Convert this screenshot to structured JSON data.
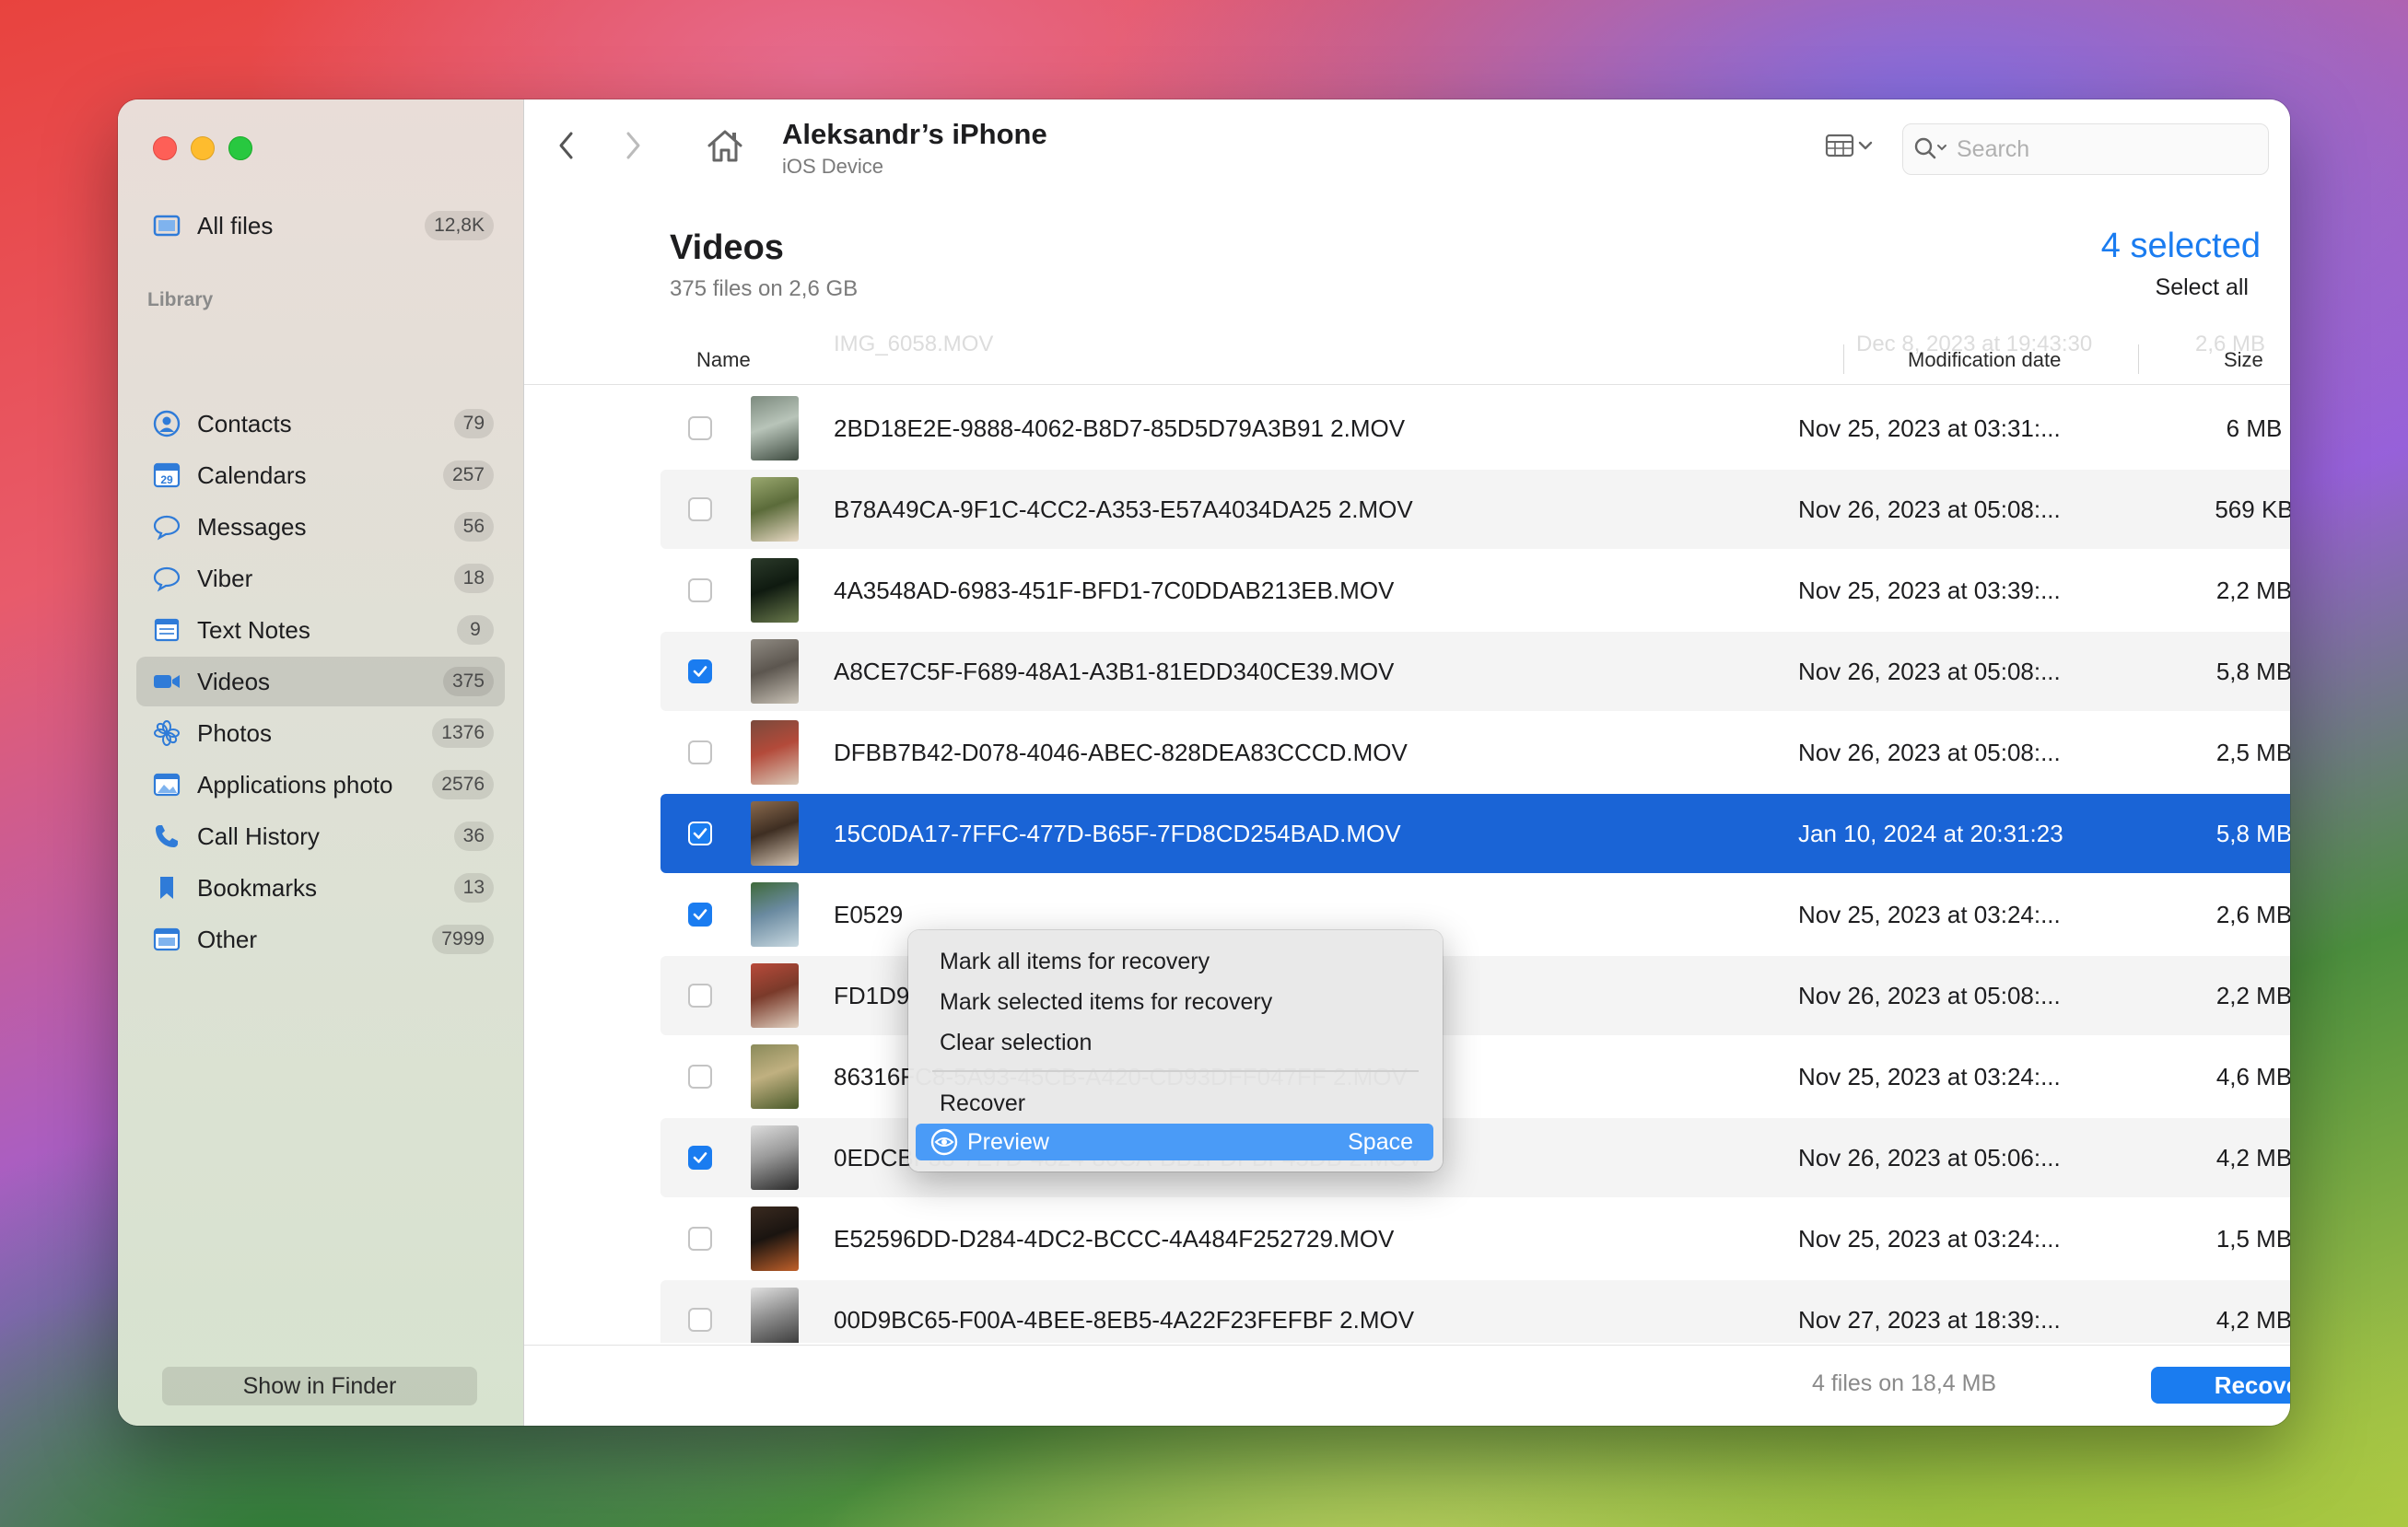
{
  "window": {
    "device_name": "Aleksandr’s iPhone",
    "device_type": "iOS Device"
  },
  "sidebar": {
    "all_files": {
      "label": "All files",
      "count": "12,8K"
    },
    "library_header": "Library",
    "items": [
      {
        "label": "Contacts",
        "count": "79",
        "icon": "contacts-icon"
      },
      {
        "label": "Calendars",
        "count": "257",
        "icon": "calendar-icon"
      },
      {
        "label": "Messages",
        "count": "56",
        "icon": "message-bubble-icon"
      },
      {
        "label": "Viber",
        "count": "18",
        "icon": "viber-bubble-icon"
      },
      {
        "label": "Text Notes",
        "count": "9",
        "icon": "notes-icon"
      },
      {
        "label": "Videos",
        "count": "375",
        "icon": "video-camera-icon"
      },
      {
        "label": "Photos",
        "count": "1376",
        "icon": "photos-flower-icon"
      },
      {
        "label": "Applications photo",
        "count": "2576",
        "icon": "app-photo-icon"
      },
      {
        "label": "Call History",
        "count": "36",
        "icon": "phone-icon"
      },
      {
        "label": "Bookmarks",
        "count": "13",
        "icon": "bookmark-icon"
      },
      {
        "label": "Other",
        "count": "7999",
        "icon": "folder-icon"
      }
    ],
    "show_in_finder": "Show in Finder"
  },
  "toolbar": {
    "search_placeholder": "Search"
  },
  "content": {
    "title": "Videos",
    "subtitle": "375 files on 2,6 GB",
    "selected_count": "4 selected",
    "select_all": "Select all",
    "columns": {
      "name": "Name",
      "date": "Modification date",
      "size": "Size"
    },
    "ghost_row": {
      "name": "IMG_6058.MOV",
      "date": "Dec 8, 2023 at 19:43:30",
      "size": "2,6 MB"
    },
    "rows": [
      {
        "name": "2BD18E2E-9888-4062-B8D7-85D5D79A3B91 2.MOV",
        "date": "Nov 25, 2023 at 03:31:...",
        "size": "6 MB",
        "checked": false
      },
      {
        "name": "B78A49CA-9F1C-4CC2-A353-E57A4034DA25 2.MOV",
        "date": "Nov 26, 2023 at 05:08:...",
        "size": "569 KB",
        "checked": false
      },
      {
        "name": "4A3548AD-6983-451F-BFD1-7C0DDAB213EB.MOV",
        "date": "Nov 25, 2023 at 03:39:...",
        "size": "2,2 MB",
        "checked": false
      },
      {
        "name": "A8CE7C5F-F689-48A1-A3B1-81EDD340CE39.MOV",
        "date": "Nov 26, 2023 at 05:08:...",
        "size": "5,8 MB",
        "checked": true
      },
      {
        "name": "DFBB7B42-D078-4046-ABEC-828DEA83CCCD.MOV",
        "date": "Nov 26, 2023 at 05:08:...",
        "size": "2,5 MB",
        "checked": false
      },
      {
        "name": "15C0DA17-7FFC-477D-B65F-7FD8CD254BAD.MOV",
        "date": "Jan 10, 2024 at 20:31:23",
        "size": "5,8 MB",
        "checked": true
      },
      {
        "name": "E0529",
        "date": "Nov 25, 2023 at 03:24:...",
        "size": "2,6 MB",
        "checked": true
      },
      {
        "name": "FD1D9",
        "date": "Nov 26, 2023 at 05:08:...",
        "size": "2,2 MB",
        "checked": false
      },
      {
        "name": "86316FC8-5A93-45CB-A420-CD93DFF047FF 2.MOV",
        "date": "Nov 25, 2023 at 03:24:...",
        "size": "4,6 MB",
        "checked": false
      },
      {
        "name": "0EDCBF38-7E7D-4824-86CA-BB1FDFBF45DB 2.MOV",
        "date": "Nov 26, 2023 at 05:06:...",
        "size": "4,2 MB",
        "checked": true
      },
      {
        "name": "E52596DD-D284-4DC2-BCCC-4A484F252729.MOV",
        "date": "Nov 25, 2023 at 03:24:...",
        "size": "1,5 MB",
        "checked": false
      },
      {
        "name": "00D9BC65-F00A-4BEE-8EB5-4A22F23FEFBF 2.MOV",
        "date": "Nov 27, 2023 at 18:39:...",
        "size": "4,2 MB",
        "checked": false
      }
    ]
  },
  "context_menu": {
    "mark_all": "Mark all items for recovery",
    "mark_selected": "Mark selected items for recovery",
    "clear_selection": "Clear selection",
    "recover": "Recover",
    "preview": "Preview",
    "preview_shortcut": "Space"
  },
  "footer": {
    "files_info": "4 files on 18,4 MB",
    "recover_button": "Recover"
  },
  "colors": {
    "accent": "#1a7cf0",
    "selected_row": "#1a64d6",
    "menu_highlight": "#4a9bf7"
  }
}
